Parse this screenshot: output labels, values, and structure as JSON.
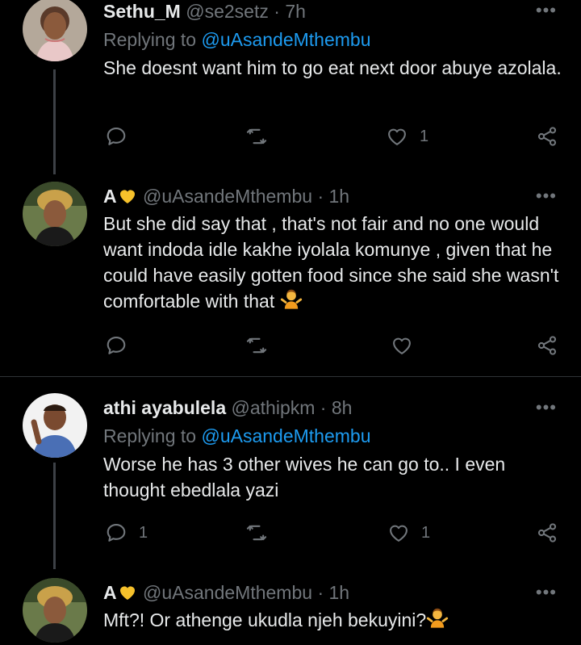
{
  "tweets": [
    {
      "name": "Sethu_M",
      "handle": "@se2setz",
      "time": "7h",
      "replying_prefix": "Replying to",
      "replying_to": "@uAsandeMthembu",
      "text": "She doesnt want him to go eat next door abuye azolala.",
      "reply_count": "",
      "like_count": "1"
    },
    {
      "name": "A",
      "handle": "@uAsandeMthembu",
      "time": "1h",
      "text": "But she did say that , that's not fair and no one would want indoda idle kakhe iyolala komunye , given that he could have easily gotten food since she said she wasn't comfortable with that",
      "reply_count": "",
      "like_count": ""
    },
    {
      "name": "athi ayabulela",
      "handle": "@athipkm",
      "time": "8h",
      "replying_prefix": "Replying to",
      "replying_to": "@uAsandeMthembu",
      "text": "Worse he has 3 other wives he can go to.. I even thought ebedlala yazi",
      "reply_count": "1",
      "like_count": "1"
    },
    {
      "name": "A",
      "handle": "@uAsandeMthembu",
      "time": "1h",
      "text": "Mft?! Or athenge ukudla njeh bekuyini?",
      "reply_count": "",
      "like_count": ""
    }
  ],
  "separator": "·",
  "more_glyph": "•••",
  "icons": {
    "reply": "reply-icon",
    "retweet": "retweet-icon",
    "like": "heart-icon",
    "share": "share-icon",
    "more": "more-icon"
  },
  "colors": {
    "background": "#000000",
    "text": "#e7e9ea",
    "muted": "#71767b",
    "link": "#1d9bf0",
    "heart_emoji": "#f6c12b"
  }
}
